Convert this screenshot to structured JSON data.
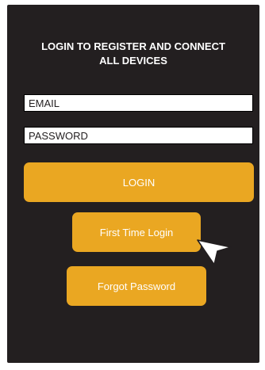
{
  "screen": {
    "title_line1": "LOGIN TO REGISTER AND CONNECT",
    "title_line2": "ALL DEVICES"
  },
  "form": {
    "email_placeholder": "EMAIL",
    "password_placeholder": "PASSWORD"
  },
  "buttons": {
    "login_label": "LOGIN",
    "first_time_label": "First Time Login",
    "forgot_label": "Forgot Password"
  },
  "colors": {
    "background": "#231f20",
    "accent": "#eaa722",
    "text": "#ffffff"
  },
  "icons": {
    "pointer": "cursor-arrow-icon"
  }
}
